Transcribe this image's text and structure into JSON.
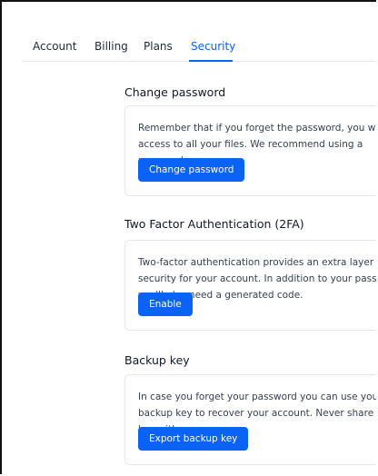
{
  "tabs": {
    "account": "Account",
    "billing": "Billing",
    "plans": "Plans",
    "security": "Security"
  },
  "sections": {
    "change_password": {
      "title": "Change password",
      "description": "Remember that if you forget the password, you will lose access to all your files. We recommend using a password manager.",
      "button": "Change password"
    },
    "two_factor": {
      "title": "Two Factor Authentication (2FA)",
      "description": "Two-factor authentication provides an extra layer of security for your account. In addition to your password, you'll also need a generated code.",
      "button": "Enable"
    },
    "backup_key": {
      "title": "Backup key",
      "description": "In case you forget your password you can use your backup key to recover your account. Never share this key with anyone.",
      "button": "Export backup key"
    }
  },
  "colors": {
    "accent": "#0b63f6",
    "border": "#e5e7eb"
  }
}
